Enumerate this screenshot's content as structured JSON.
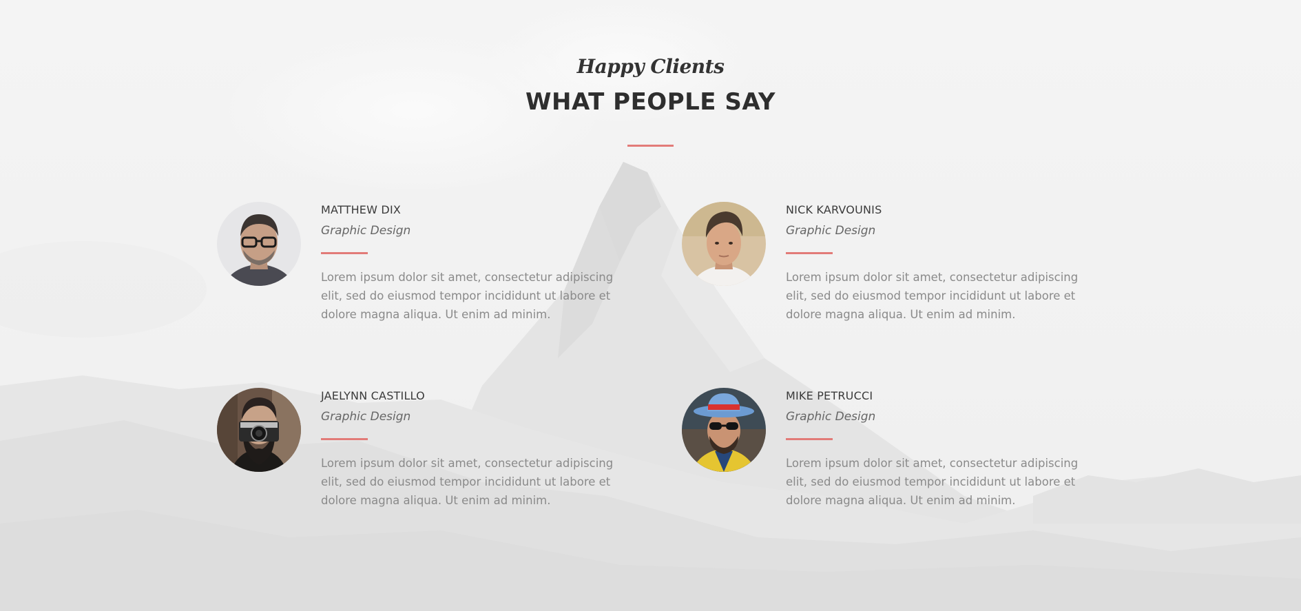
{
  "header": {
    "subtitle": "Happy Clients",
    "title": "WHAT PEOPLE SAY"
  },
  "testimonials": [
    {
      "name": "MATTHEW DIX",
      "role": "Graphic Design",
      "text": "Lorem ipsum dolor sit amet, consectetur adipiscing elit, sed do eiusmod tempor incididunt ut labore et dolore magna aliqua. Ut enim ad minim."
    },
    {
      "name": "NICK KARVOUNIS",
      "role": "Graphic Design",
      "text": "Lorem ipsum dolor sit amet, consectetur adipiscing elit, sed do eiusmod tempor incididunt ut labore et dolore magna aliqua. Ut enim ad minim."
    },
    {
      "name": "JAELYNN CASTILLO",
      "role": "Graphic Design",
      "text": "Lorem ipsum dolor sit amet, consectetur adipiscing elit, sed do eiusmod tempor incididunt ut labore et dolore magna aliqua. Ut enim ad minim."
    },
    {
      "name": "MIKE PETRUCCI",
      "role": "Graphic Design",
      "text": "Lorem ipsum dolor sit amet, consectetur adipiscing elit, sed do eiusmod tempor incididunt ut labore et dolore magna aliqua. Ut enim ad minim."
    }
  ],
  "colors": {
    "accent": "#e27b78",
    "heading": "#2e2e2e",
    "body_text": "#8a8a8a",
    "background": "#f3f3f3"
  }
}
